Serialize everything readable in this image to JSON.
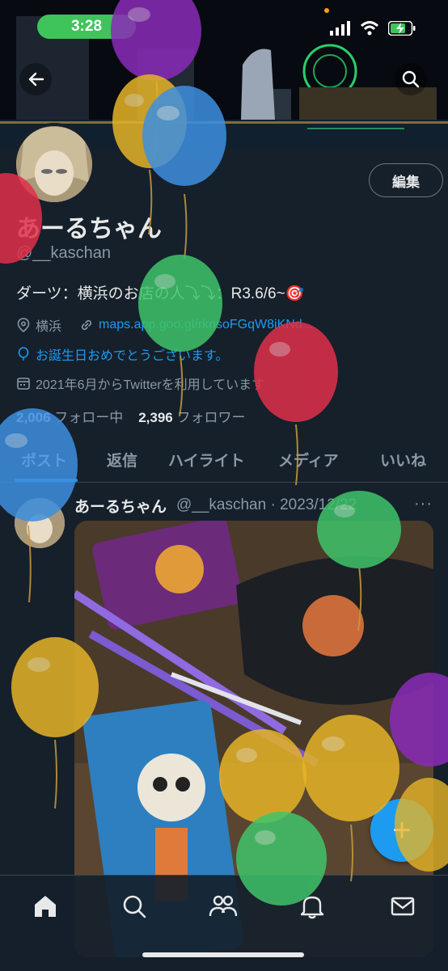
{
  "status_bar": {
    "time": "3:28"
  },
  "header": {
    "back_label": "back",
    "search_label": "search"
  },
  "profile": {
    "edit_label": "編集",
    "name": "あーるちゃん",
    "handle": "@__kaschan",
    "bio": "ダーツ：横浜のお店の人⤵︎⤵︎：R3.6/6~🎯",
    "location": "横浜",
    "link": "maps.app.goo.gl/rknsoFGqW8iKNd...",
    "birthday": "お誕生日おめでとうございます。",
    "joined": "2021年6月からTwitterを利用しています",
    "following_count": "2,006",
    "following_label": "フォロー中",
    "followers_count": "2,396",
    "followers_label": "フォロワー"
  },
  "tabs": [
    {
      "label": "ポスト",
      "active": true
    },
    {
      "label": "返信",
      "active": false
    },
    {
      "label": "ハイライト",
      "active": false
    },
    {
      "label": "メディア",
      "active": false
    },
    {
      "label": "いいね",
      "active": false
    }
  ],
  "post": {
    "author_name": "あーるちゃん",
    "author_handle": "@__kaschan",
    "date": "· 2023/12/22",
    "more": "···"
  },
  "fab": {
    "label": "+"
  },
  "bottom_nav": [
    "home-icon",
    "search-icon",
    "communities-icon",
    "bell-icon",
    "mail-icon"
  ],
  "colors": {
    "background": "#15202b",
    "accent": "#1d9bf0",
    "text": "#e7e9ea",
    "muted": "#8b98a5",
    "time_pill": "#3fc45b"
  }
}
